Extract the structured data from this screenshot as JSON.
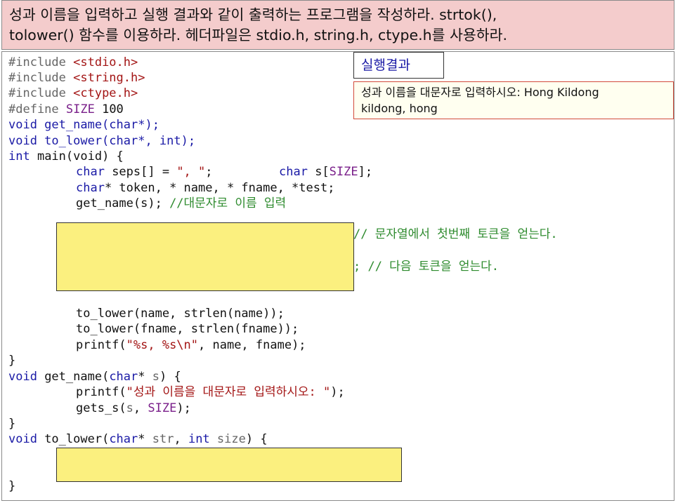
{
  "header": {
    "line1": "성과 이름을 입력하고 실행 결과와 같이 출력하는 프로그램을 작성하라. strtok(),",
    "line2": "tolower() 함수를 이용하라. 헤더파일은 stdio.h, string.h, ctype.h를 사용하라."
  },
  "code": {
    "inc1": "#include ",
    "inc1_file": "<stdio.h>",
    "inc2": "#include ",
    "inc2_file": "<string.h>",
    "inc3": "#include ",
    "inc3_file": "<ctype.h>",
    "def_kw": "#define ",
    "def_name": "SIZE",
    "def_val": " 100",
    "proto1": "void get_name(char*);",
    "proto2": "void to_lower(char*, int);",
    "main_int": "int",
    "main_rest": " main(void) {",
    "seps_kw": "char",
    "seps_mid": " seps[] = ",
    "seps_str": "\", \"",
    "seps_sc": ";",
    "s_kw": "char",
    "s_mid": " s[",
    "s_size": "SIZE",
    "s_end": "];",
    "tok_kw": "char",
    "tok_rest": "* token, * name, * fname, *test;",
    "getname_call": "get_name(s); ",
    "getname_cmt": "//대문자로 이름 입력",
    "cmt_first_token": "// 문자열에서 첫번째 토큰을 얻는다.",
    "cmt_next_token": "; // 다음 토큰을 얻는다.",
    "lower1": "to_lower(name, strlen(name));",
    "lower2": "to_lower(fname, strlen(fname));",
    "printf1_a": "printf(",
    "printf1_str": "\"%s, %s\\n\"",
    "printf1_b": ", name, fname);",
    "close1": "}",
    "gn_void": "void",
    "gn_mid": " get_name(",
    "gn_char": "char",
    "gn_star": "* ",
    "gn_s": "s",
    "gn_end": ") {",
    "pf2_a": "printf(",
    "pf2_str": "\"성과 이름을 대문자로 입력하시오: \"",
    "pf2_b": ");",
    "gets_a": "gets_s(",
    "gets_s": "s",
    "gets_comma": ", ",
    "gets_size": "SIZE",
    "gets_end": ");",
    "close2": "}",
    "tl_void": "void",
    "tl_mid": " to_lower(",
    "tl_char": "char",
    "tl_star": "* ",
    "tl_str": "str",
    "tl_comma": ", ",
    "tl_int": "int",
    "tl_size": " size",
    "tl_end": ") {",
    "close3": "}"
  },
  "result": {
    "title": "실행결과",
    "line1": "성과 이름을 대문자로 입력하시오: Hong Kildong",
    "line2": "kildong, hong"
  }
}
